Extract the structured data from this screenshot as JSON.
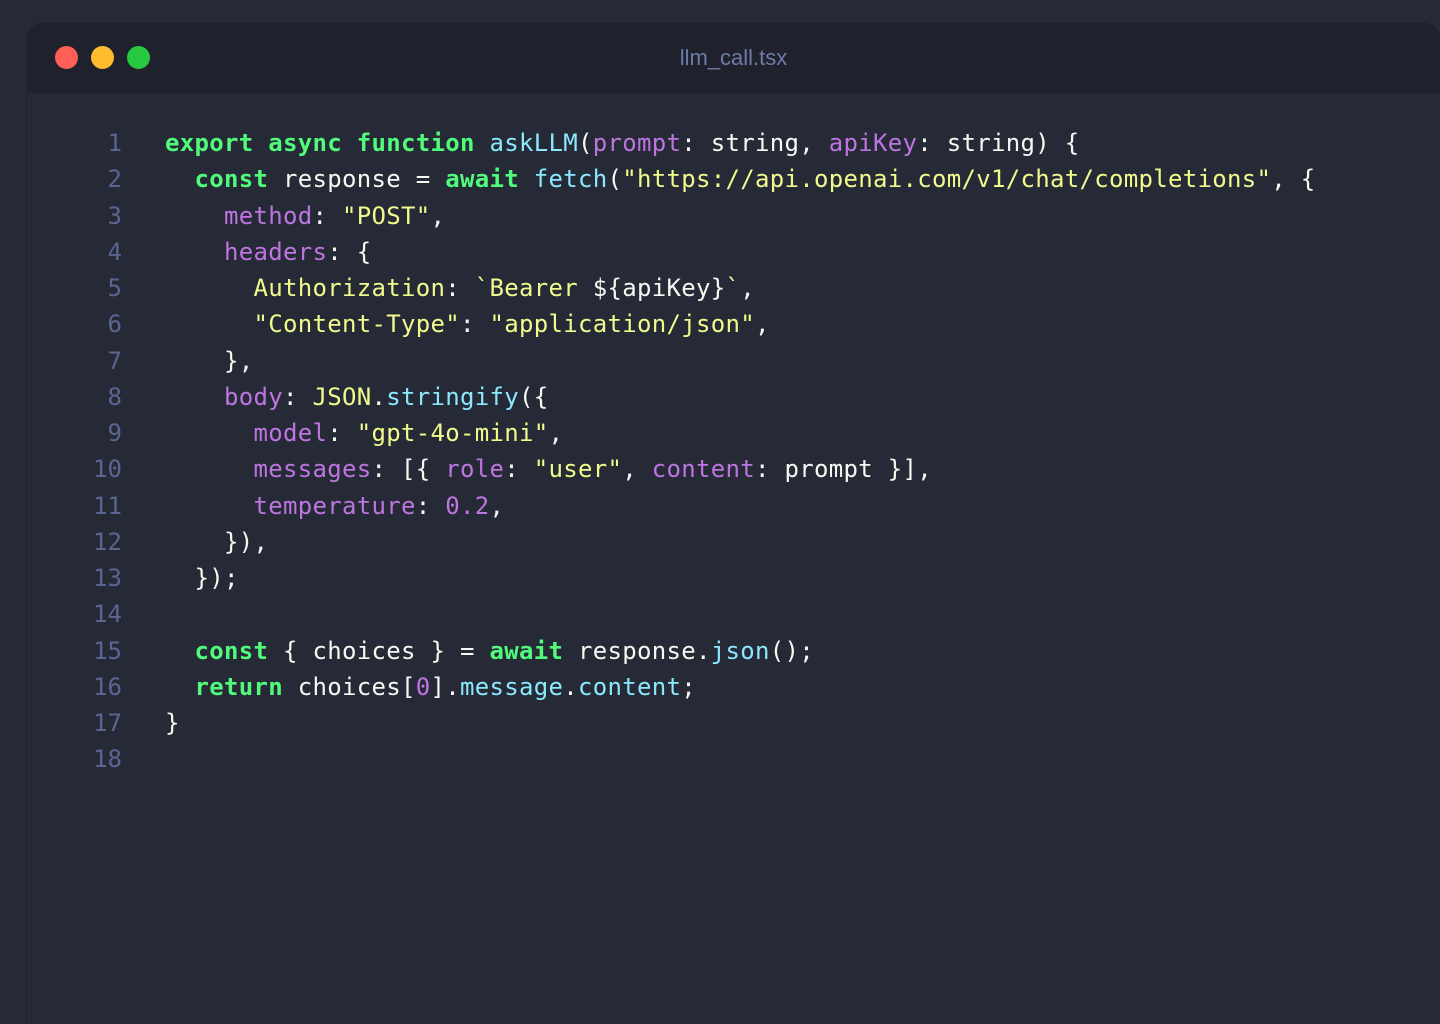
{
  "window": {
    "title": "llm_call.tsx"
  },
  "colors": {
    "red": "#ff5f57",
    "yellow": "#febc2e",
    "green": "#28c840",
    "keyword": "#50fa7b",
    "function": "#8be9fd",
    "property": "#bd76e0",
    "string": "#f1fa8c",
    "plain": "#f8f8f2",
    "number": "#bd76e0",
    "line_number": "#5a6691"
  },
  "lines": [
    {
      "n": "1",
      "tokens": [
        {
          "t": "export async function",
          "c": "keyword"
        },
        {
          "t": " ",
          "c": "plain"
        },
        {
          "t": "askLLM",
          "c": "function"
        },
        {
          "t": "(",
          "c": "plain"
        },
        {
          "t": "prompt",
          "c": "property"
        },
        {
          "t": ": string, ",
          "c": "plain"
        },
        {
          "t": "apiKey",
          "c": "property"
        },
        {
          "t": ": string) {",
          "c": "plain"
        }
      ]
    },
    {
      "n": "2",
      "tokens": [
        {
          "t": "  ",
          "c": "plain"
        },
        {
          "t": "const",
          "c": "keyword"
        },
        {
          "t": " response = ",
          "c": "plain"
        },
        {
          "t": "await",
          "c": "keyword"
        },
        {
          "t": " ",
          "c": "plain"
        },
        {
          "t": "fetch",
          "c": "function"
        },
        {
          "t": "(",
          "c": "plain"
        },
        {
          "t": "\"https://api.openai.com/v1/chat/completions\"",
          "c": "string"
        },
        {
          "t": ", {",
          "c": "plain"
        }
      ]
    },
    {
      "n": "3",
      "tokens": [
        {
          "t": "    ",
          "c": "plain"
        },
        {
          "t": "method",
          "c": "property"
        },
        {
          "t": ": ",
          "c": "plain"
        },
        {
          "t": "\"POST\"",
          "c": "string"
        },
        {
          "t": ",",
          "c": "plain"
        }
      ]
    },
    {
      "n": "4",
      "tokens": [
        {
          "t": "    ",
          "c": "plain"
        },
        {
          "t": "headers",
          "c": "property"
        },
        {
          "t": ": {",
          "c": "plain"
        }
      ]
    },
    {
      "n": "5",
      "tokens": [
        {
          "t": "      ",
          "c": "plain"
        },
        {
          "t": "Authorization",
          "c": "string"
        },
        {
          "t": ": ",
          "c": "plain"
        },
        {
          "t": "`Bearer ",
          "c": "string"
        },
        {
          "t": "${apiKey}",
          "c": "plain"
        },
        {
          "t": "`",
          "c": "string"
        },
        {
          "t": ",",
          "c": "plain"
        }
      ]
    },
    {
      "n": "6",
      "tokens": [
        {
          "t": "      ",
          "c": "plain"
        },
        {
          "t": "\"Content-Type\"",
          "c": "string"
        },
        {
          "t": ": ",
          "c": "plain"
        },
        {
          "t": "\"application/json\"",
          "c": "string"
        },
        {
          "t": ",",
          "c": "plain"
        }
      ]
    },
    {
      "n": "7",
      "tokens": [
        {
          "t": "    },",
          "c": "plain"
        }
      ]
    },
    {
      "n": "8",
      "tokens": [
        {
          "t": "    ",
          "c": "plain"
        },
        {
          "t": "body",
          "c": "property"
        },
        {
          "t": ": ",
          "c": "plain"
        },
        {
          "t": "JSON",
          "c": "string"
        },
        {
          "t": ".",
          "c": "plain"
        },
        {
          "t": "stringify",
          "c": "function"
        },
        {
          "t": "({",
          "c": "plain"
        }
      ]
    },
    {
      "n": "9",
      "tokens": [
        {
          "t": "      ",
          "c": "plain"
        },
        {
          "t": "model",
          "c": "property"
        },
        {
          "t": ": ",
          "c": "plain"
        },
        {
          "t": "\"gpt-4o-mini\"",
          "c": "string"
        },
        {
          "t": ",",
          "c": "plain"
        }
      ]
    },
    {
      "n": "10",
      "tokens": [
        {
          "t": "      ",
          "c": "plain"
        },
        {
          "t": "messages",
          "c": "property"
        },
        {
          "t": ": [{ ",
          "c": "plain"
        },
        {
          "t": "role",
          "c": "property"
        },
        {
          "t": ": ",
          "c": "plain"
        },
        {
          "t": "\"user\"",
          "c": "string"
        },
        {
          "t": ", ",
          "c": "plain"
        },
        {
          "t": "content",
          "c": "property"
        },
        {
          "t": ": prompt }],",
          "c": "plain"
        }
      ]
    },
    {
      "n": "11",
      "tokens": [
        {
          "t": "      ",
          "c": "plain"
        },
        {
          "t": "temperature",
          "c": "property"
        },
        {
          "t": ": ",
          "c": "plain"
        },
        {
          "t": "0.2",
          "c": "number"
        },
        {
          "t": ",",
          "c": "plain"
        }
      ]
    },
    {
      "n": "12",
      "tokens": [
        {
          "t": "    }),",
          "c": "plain"
        }
      ]
    },
    {
      "n": "13",
      "tokens": [
        {
          "t": "  });",
          "c": "plain"
        }
      ]
    },
    {
      "n": "14",
      "tokens": []
    },
    {
      "n": "15",
      "tokens": [
        {
          "t": "  ",
          "c": "plain"
        },
        {
          "t": "const",
          "c": "keyword"
        },
        {
          "t": " { choices } = ",
          "c": "plain"
        },
        {
          "t": "await",
          "c": "keyword"
        },
        {
          "t": " response.",
          "c": "plain"
        },
        {
          "t": "json",
          "c": "function"
        },
        {
          "t": "();",
          "c": "plain"
        }
      ]
    },
    {
      "n": "16",
      "tokens": [
        {
          "t": "  ",
          "c": "plain"
        },
        {
          "t": "return",
          "c": "keyword"
        },
        {
          "t": " choices[",
          "c": "plain"
        },
        {
          "t": "0",
          "c": "number"
        },
        {
          "t": "].",
          "c": "plain"
        },
        {
          "t": "message",
          "c": "function"
        },
        {
          "t": ".",
          "c": "plain"
        },
        {
          "t": "content",
          "c": "function"
        },
        {
          "t": ";",
          "c": "plain"
        }
      ]
    },
    {
      "n": "17",
      "tokens": [
        {
          "t": "}",
          "c": "plain"
        }
      ]
    },
    {
      "n": "18",
      "tokens": []
    }
  ]
}
